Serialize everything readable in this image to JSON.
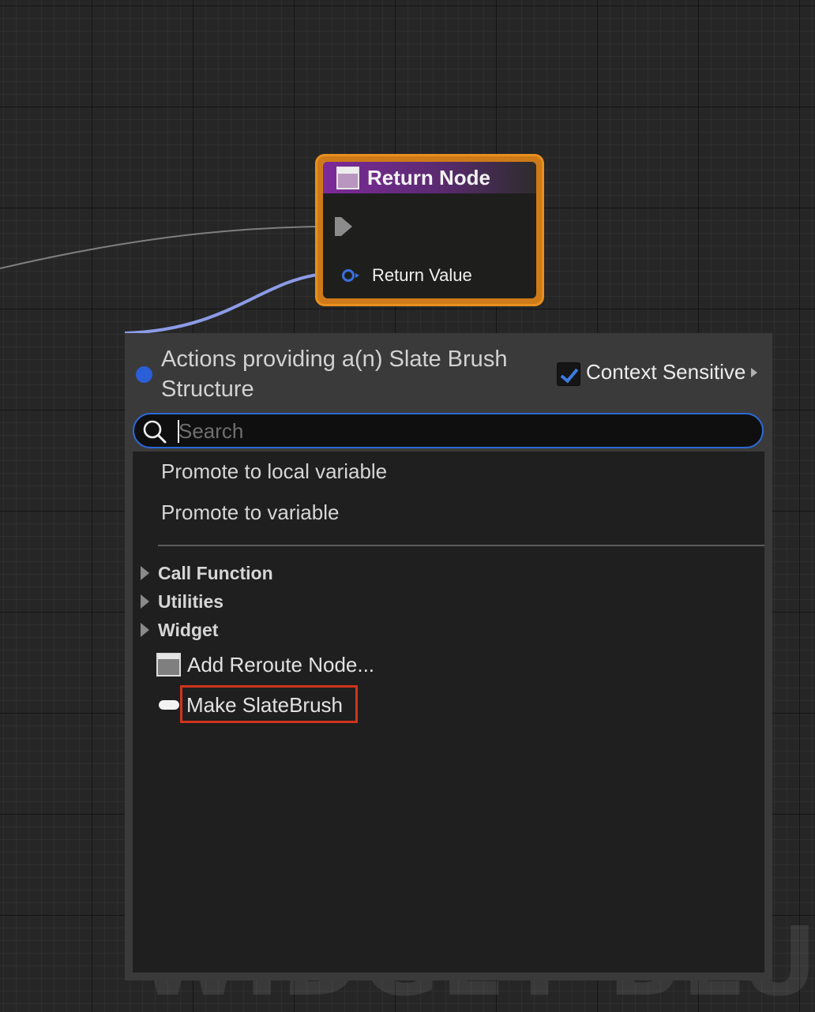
{
  "node": {
    "title": "Return Node",
    "pins": {
      "return_value_label": "Return Value"
    }
  },
  "menu": {
    "header": {
      "title": "Actions providing a(n) Slate Brush Structure",
      "context_sensitive": {
        "label": "Context Sensitive",
        "checked": true
      }
    },
    "search": {
      "placeholder": "Search",
      "value": ""
    },
    "actions": [
      "Promote to local variable",
      "Promote to variable"
    ],
    "categories": [
      "Call Function",
      "Utilities",
      "Widget"
    ],
    "items": [
      {
        "label": "Add Reroute Node...",
        "icon": "reroute-node-icon"
      },
      {
        "label": "Make SlateBrush",
        "icon": "struct-pin-icon",
        "highlighted": true
      }
    ]
  },
  "watermark": "WIDGET BLUEPRINT",
  "colors": {
    "node_border": "#e8901f",
    "node_header": "#7d2a9a",
    "struct_wire": "#8c9be6",
    "exec_wire": "#8a8a8a",
    "search_border": "#2b69d6",
    "highlight_box": "#d0341e"
  }
}
